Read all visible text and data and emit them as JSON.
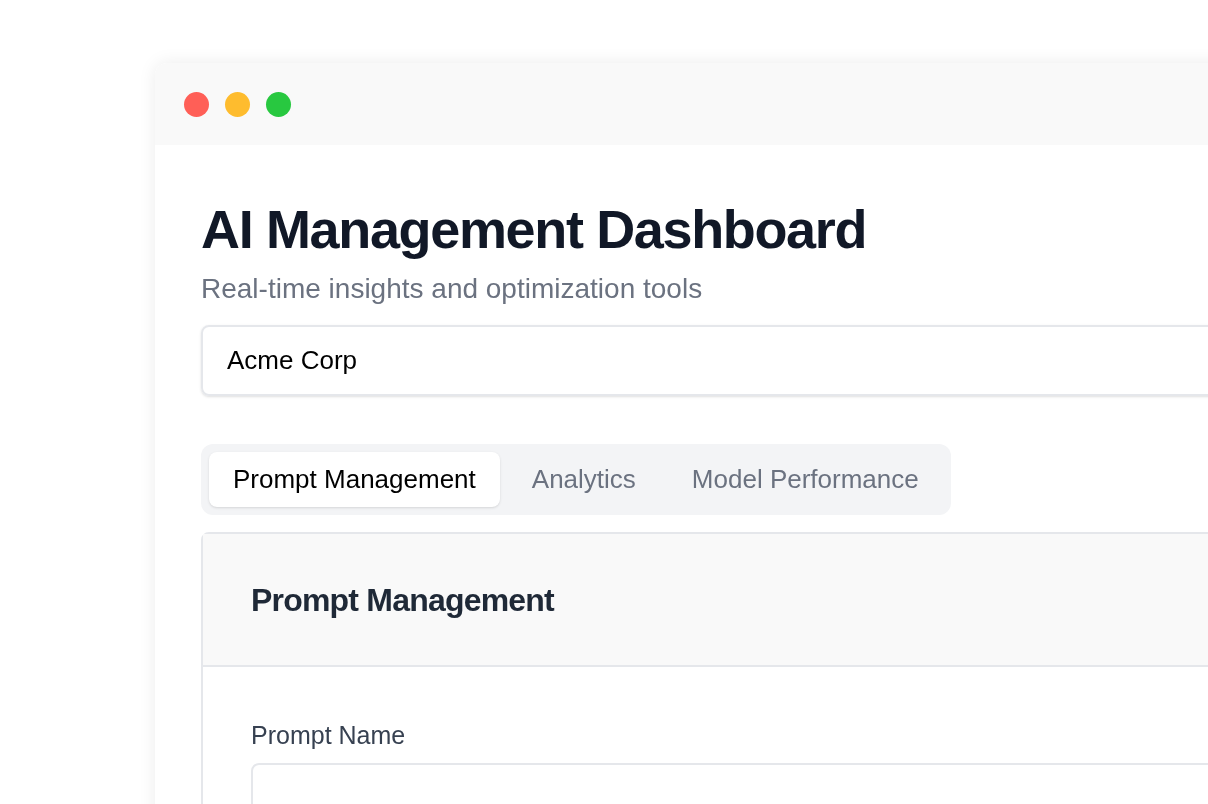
{
  "window": {
    "controls": [
      {
        "color": "#ff5f57"
      },
      {
        "color": "#febc2e"
      },
      {
        "color": "#28c840"
      }
    ]
  },
  "header": {
    "title": "AI Management Dashboard",
    "subtitle": "Real-time insights and optimization tools"
  },
  "organization_field": {
    "value": "Acme Corp"
  },
  "tabs": [
    {
      "label": "Prompt Management",
      "selected": true
    },
    {
      "label": "Analytics",
      "selected": false
    },
    {
      "label": "Model Performance",
      "selected": false
    }
  ],
  "card": {
    "title": "Prompt Management",
    "fields": [
      {
        "label": "Prompt Name"
      }
    ]
  }
}
